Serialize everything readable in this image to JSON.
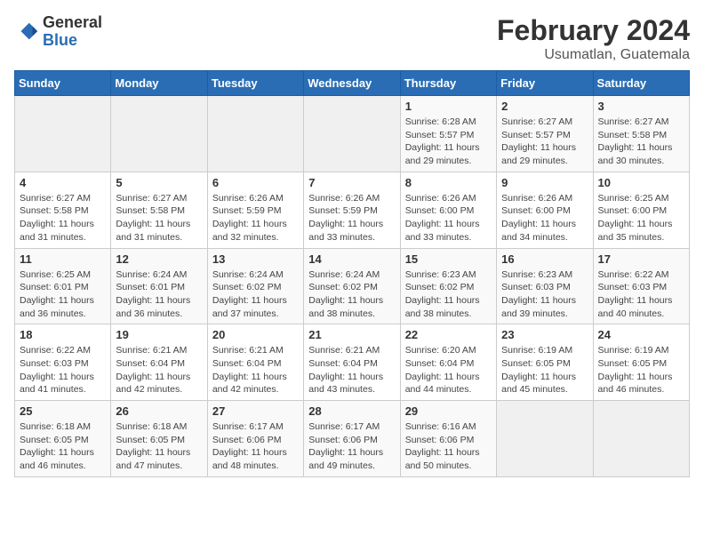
{
  "header": {
    "logo_general": "General",
    "logo_blue": "Blue",
    "main_title": "February 2024",
    "sub_title": "Usumatlan, Guatemala"
  },
  "calendar": {
    "days_of_week": [
      "Sunday",
      "Monday",
      "Tuesday",
      "Wednesday",
      "Thursday",
      "Friday",
      "Saturday"
    ],
    "weeks": [
      [
        {
          "day": "",
          "info": ""
        },
        {
          "day": "",
          "info": ""
        },
        {
          "day": "",
          "info": ""
        },
        {
          "day": "",
          "info": ""
        },
        {
          "day": "1",
          "info": "Sunrise: 6:28 AM\nSunset: 5:57 PM\nDaylight: 11 hours and 29 minutes."
        },
        {
          "day": "2",
          "info": "Sunrise: 6:27 AM\nSunset: 5:57 PM\nDaylight: 11 hours and 29 minutes."
        },
        {
          "day": "3",
          "info": "Sunrise: 6:27 AM\nSunset: 5:58 PM\nDaylight: 11 hours and 30 minutes."
        }
      ],
      [
        {
          "day": "4",
          "info": "Sunrise: 6:27 AM\nSunset: 5:58 PM\nDaylight: 11 hours and 31 minutes."
        },
        {
          "day": "5",
          "info": "Sunrise: 6:27 AM\nSunset: 5:58 PM\nDaylight: 11 hours and 31 minutes."
        },
        {
          "day": "6",
          "info": "Sunrise: 6:26 AM\nSunset: 5:59 PM\nDaylight: 11 hours and 32 minutes."
        },
        {
          "day": "7",
          "info": "Sunrise: 6:26 AM\nSunset: 5:59 PM\nDaylight: 11 hours and 33 minutes."
        },
        {
          "day": "8",
          "info": "Sunrise: 6:26 AM\nSunset: 6:00 PM\nDaylight: 11 hours and 33 minutes."
        },
        {
          "day": "9",
          "info": "Sunrise: 6:26 AM\nSunset: 6:00 PM\nDaylight: 11 hours and 34 minutes."
        },
        {
          "day": "10",
          "info": "Sunrise: 6:25 AM\nSunset: 6:00 PM\nDaylight: 11 hours and 35 minutes."
        }
      ],
      [
        {
          "day": "11",
          "info": "Sunrise: 6:25 AM\nSunset: 6:01 PM\nDaylight: 11 hours and 36 minutes."
        },
        {
          "day": "12",
          "info": "Sunrise: 6:24 AM\nSunset: 6:01 PM\nDaylight: 11 hours and 36 minutes."
        },
        {
          "day": "13",
          "info": "Sunrise: 6:24 AM\nSunset: 6:02 PM\nDaylight: 11 hours and 37 minutes."
        },
        {
          "day": "14",
          "info": "Sunrise: 6:24 AM\nSunset: 6:02 PM\nDaylight: 11 hours and 38 minutes."
        },
        {
          "day": "15",
          "info": "Sunrise: 6:23 AM\nSunset: 6:02 PM\nDaylight: 11 hours and 38 minutes."
        },
        {
          "day": "16",
          "info": "Sunrise: 6:23 AM\nSunset: 6:03 PM\nDaylight: 11 hours and 39 minutes."
        },
        {
          "day": "17",
          "info": "Sunrise: 6:22 AM\nSunset: 6:03 PM\nDaylight: 11 hours and 40 minutes."
        }
      ],
      [
        {
          "day": "18",
          "info": "Sunrise: 6:22 AM\nSunset: 6:03 PM\nDaylight: 11 hours and 41 minutes."
        },
        {
          "day": "19",
          "info": "Sunrise: 6:21 AM\nSunset: 6:04 PM\nDaylight: 11 hours and 42 minutes."
        },
        {
          "day": "20",
          "info": "Sunrise: 6:21 AM\nSunset: 6:04 PM\nDaylight: 11 hours and 42 minutes."
        },
        {
          "day": "21",
          "info": "Sunrise: 6:21 AM\nSunset: 6:04 PM\nDaylight: 11 hours and 43 minutes."
        },
        {
          "day": "22",
          "info": "Sunrise: 6:20 AM\nSunset: 6:04 PM\nDaylight: 11 hours and 44 minutes."
        },
        {
          "day": "23",
          "info": "Sunrise: 6:19 AM\nSunset: 6:05 PM\nDaylight: 11 hours and 45 minutes."
        },
        {
          "day": "24",
          "info": "Sunrise: 6:19 AM\nSunset: 6:05 PM\nDaylight: 11 hours and 46 minutes."
        }
      ],
      [
        {
          "day": "25",
          "info": "Sunrise: 6:18 AM\nSunset: 6:05 PM\nDaylight: 11 hours and 46 minutes."
        },
        {
          "day": "26",
          "info": "Sunrise: 6:18 AM\nSunset: 6:05 PM\nDaylight: 11 hours and 47 minutes."
        },
        {
          "day": "27",
          "info": "Sunrise: 6:17 AM\nSunset: 6:06 PM\nDaylight: 11 hours and 48 minutes."
        },
        {
          "day": "28",
          "info": "Sunrise: 6:17 AM\nSunset: 6:06 PM\nDaylight: 11 hours and 49 minutes."
        },
        {
          "day": "29",
          "info": "Sunrise: 6:16 AM\nSunset: 6:06 PM\nDaylight: 11 hours and 50 minutes."
        },
        {
          "day": "",
          "info": ""
        },
        {
          "day": "",
          "info": ""
        }
      ]
    ]
  }
}
